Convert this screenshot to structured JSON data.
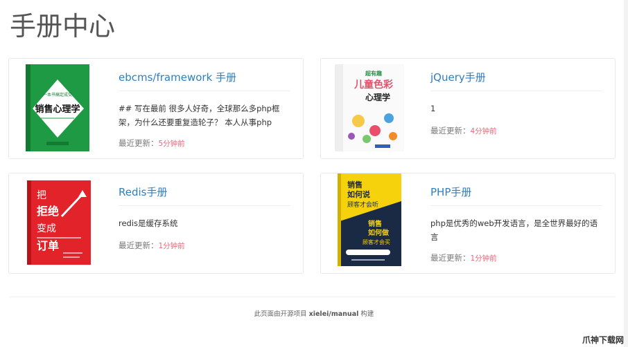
{
  "page": {
    "title": "手册中心"
  },
  "cards": [
    {
      "title": "ebcms/framework 手册",
      "desc": "## 写在最前 很多人好奇，全球那么多php框架，为什么还要重复造轮子？ 本人从事php",
      "updated_label": "最近更新：",
      "updated_time": "5分钟前",
      "cover": {
        "lines": [
          "一本书搞定成交",
          "销售心理学"
        ],
        "bg": "#1f9a44"
      }
    },
    {
      "title": "jQuery手册",
      "desc": "1",
      "updated_label": "最近更新：",
      "updated_time": "4分钟前",
      "cover": {
        "lines": [
          "超有趣",
          "儿童色彩",
          "心理学"
        ],
        "bg": "#ffffff"
      }
    },
    {
      "title": "Redis手册",
      "desc": "redis是缓存系统",
      "updated_label": "最近更新：",
      "updated_time": "1分钟前",
      "cover": {
        "lines": [
          "把",
          "拒绝",
          "变成",
          "订单"
        ],
        "bg": "#e2232a"
      }
    },
    {
      "title": "PHP手册",
      "desc": "php是优秀的web开发语言，是全世界最好的语言",
      "updated_label": "最近更新：",
      "updated_time": "1分钟前",
      "cover": {
        "lines": [
          "销售",
          "如何说",
          "顾客才会听",
          "销售",
          "如何做",
          "顾客才会买"
        ],
        "bg": "#1b2a44"
      }
    }
  ],
  "footer": {
    "prefix": "此页面由开源项目 ",
    "link": "xielei/manual",
    "suffix": " 构建"
  },
  "watermark": "爪神下载网"
}
